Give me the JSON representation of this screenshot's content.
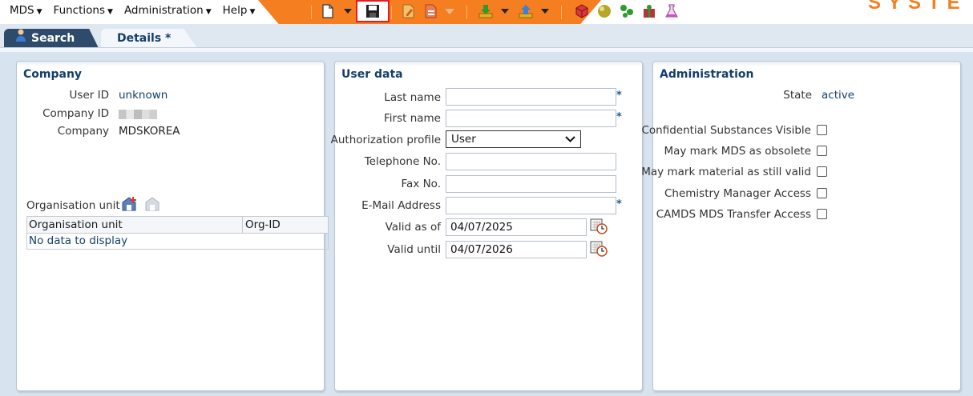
{
  "menu": [
    {
      "label": "MDS"
    },
    {
      "label": "Functions"
    },
    {
      "label": "Administration"
    },
    {
      "label": "Help"
    }
  ],
  "brand": "SYSTE",
  "tabs": {
    "search": "Search",
    "details": "Details *"
  },
  "company": {
    "title": "Company",
    "user_id_label": "User ID",
    "user_id": "unknown",
    "company_id_label": "Company ID",
    "company_label": "Company",
    "company": "MDSKOREA",
    "org_unit_label": "Organisation unit",
    "org_table": {
      "col1": "Organisation unit",
      "col2": "Org-ID",
      "empty": "No data to display"
    }
  },
  "user": {
    "title": "User data",
    "last_name_label": "Last name",
    "last_name": "",
    "first_name_label": "First name",
    "first_name": "",
    "auth_profile_label": "Authorization profile",
    "auth_profile": "User",
    "telephone_label": "Telephone No.",
    "telephone": "",
    "fax_label": "Fax No.",
    "fax": "",
    "email_label": "E-Mail Address",
    "email": "",
    "valid_as_of_label": "Valid as of",
    "valid_as_of": "04/07/2025",
    "valid_until_label": "Valid until",
    "valid_until": "04/07/2026",
    "required_mark": "*"
  },
  "admin": {
    "title": "Administration",
    "state_label": "State",
    "state": "active",
    "options": [
      {
        "label": "Confidential Substances Visible",
        "checked": false
      },
      {
        "label": "May mark MDS as obsolete",
        "checked": false
      },
      {
        "label": "May mark material as still valid",
        "checked": false
      },
      {
        "label": "Chemistry Manager Access",
        "checked": false
      },
      {
        "label": "CAMDS MDS Transfer Access",
        "checked": false
      }
    ]
  },
  "colors": {
    "accent_orange": "#f57e20",
    "title_blue": "#143f6a",
    "tab_dark": "#2f4b6b",
    "highlight_red": "#e81c1c"
  },
  "icons": [
    "new-document-icon",
    "save-icon",
    "edit-document-icon",
    "pdf-export-icon",
    "download-icon",
    "upload-icon",
    "red-cube-icon",
    "sphere-icon",
    "molecule-icon",
    "gift-icon",
    "flask-icon",
    "user-icon",
    "calendar-icon"
  ]
}
